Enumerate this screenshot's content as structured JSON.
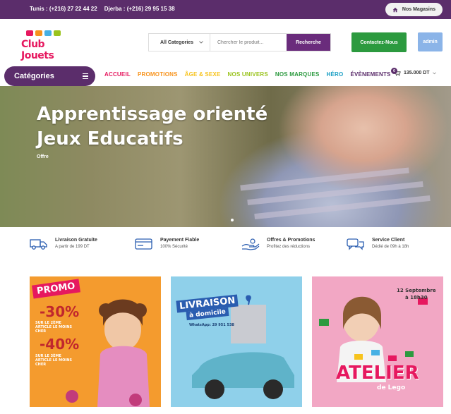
{
  "topbar": {
    "phone_tunis": "Tunis : (+216) 27 22 44 22",
    "phone_djerba": "Djerba : (+216) 29 95 15 38",
    "stores_label": "Nos Magasins"
  },
  "header": {
    "logo_text": "Club Jouets",
    "search_category": "All Categories",
    "search_placeholder": "Chercher le produit...",
    "search_button": "Recherche",
    "contact_button": "Contactez-Nous",
    "admin_button": "admin"
  },
  "nav": {
    "categories_label": "Catégories",
    "items": [
      {
        "label": "ACCUEIL",
        "color": "#e6185f"
      },
      {
        "label": "PROMOTIONS",
        "color": "#f7931d"
      },
      {
        "label": "ÂGE & SEXE",
        "color": "#f7c31d"
      },
      {
        "label": "NOS UNIVERS",
        "color": "#9ac31d"
      },
      {
        "label": "NOS MARQUES",
        "color": "#2c9a3f"
      },
      {
        "label": "HÉRO",
        "color": "#1a9fc4"
      },
      {
        "label": "ÉVÈNEMENTS",
        "color": "#5b2d6b"
      }
    ],
    "cart_count": "0",
    "cart_total": "135.000 DT"
  },
  "hero": {
    "title_line1": "Apprentissage orienté",
    "title_line2": "Jeux Educatifs",
    "subtitle": "Offre"
  },
  "features": [
    {
      "icon": "truck-icon",
      "title": "Livraison Gratuite",
      "text": "A partir de 199 DT"
    },
    {
      "icon": "credit-card-icon",
      "title": "Payement Fiable",
      "text": "100% Sécurité"
    },
    {
      "icon": "hand-offer-icon",
      "title": "Offres & Promotions",
      "text": "Profitez des réductions"
    },
    {
      "icon": "chat-icon",
      "title": "Service Client",
      "text": "Dédié de 09h à 18h"
    }
  ],
  "promos": {
    "p1": {
      "badge": "PROMO",
      "off1": "-30%",
      "off1_sub": "SUR LE 2ÈME ARTICLE LE MOINS CHER",
      "off2": "-40%",
      "off2_sub": "SUR LE 3ÈME ARTICLE LE MOINS CHER"
    },
    "p2": {
      "title": "LIVRAISON",
      "subtitle": "à domicile",
      "whatsapp": "WhatsApp: 29 951 538"
    },
    "p3": {
      "date": "12 Septembre",
      "time": "à 18h30",
      "title": "ATELIER",
      "subtitle": "de Lego"
    }
  }
}
